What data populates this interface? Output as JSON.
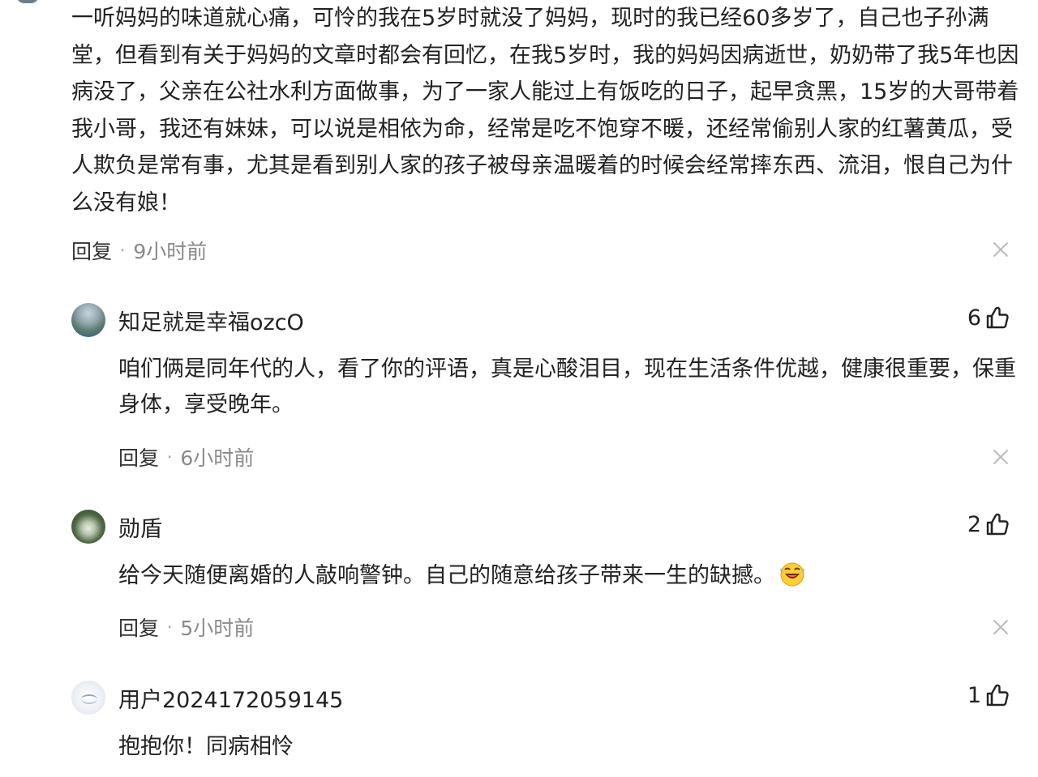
{
  "main_comment": {
    "text": "一听妈妈的味道就心痛，可怜的我在5岁时就没了妈妈，现时的我已经60多岁了，自己也子孙满堂，但看到有关于妈妈的文章时都会有回忆，在我5岁时，我的妈妈因病逝世，奶奶带了我5年也因病没了，父亲在公社水利方面做事，为了一家人能过上有饭吃的日子，起早贪黑，15岁的大哥带着我小哥，我还有妹妹，可以说是相依为命，经常是吃不饱穿不暖，还经常偷别人家的红薯黄瓜，受人欺负是常有事，尤其是看到别人家的孩子被母亲温暖着的时候会经常摔东西、流泪，恨自己为什么没有娘！",
    "reply_label": "回复",
    "separator": "·",
    "time": "9小时前"
  },
  "replies": [
    {
      "username": "知足就是幸福ozcO",
      "likes": "6",
      "text": "咱们俩是同年代的人，看了你的评语，真是心酸泪目，现在生活条件优越，健康很重要，保重身体，享受晚年。",
      "reply_label": "回复",
      "separator": "·",
      "time": "6小时前",
      "avatar_icon": "lake-landscape-avatar"
    },
    {
      "username": "勋盾",
      "likes": "2",
      "text": "给今天随便离婚的人敲响警钟。自己的随意给孩子带来一生的缺撼。",
      "emoji": "laughing-crying-emoji",
      "reply_label": "回复",
      "separator": "·",
      "time": "5小时前",
      "avatar_icon": "dandelion-avatar"
    },
    {
      "username": "用户2024172059145",
      "likes": "1",
      "text": "抱抱你！同病相怜",
      "avatar_icon": "default-user-avatar"
    }
  ],
  "icons": {
    "like": "thumbs-up-icon",
    "close": "close-icon"
  },
  "colors": {
    "text": "#222222",
    "muted": "#8a8a8a",
    "close": "#bbbbbb",
    "background": "#ffffff"
  }
}
